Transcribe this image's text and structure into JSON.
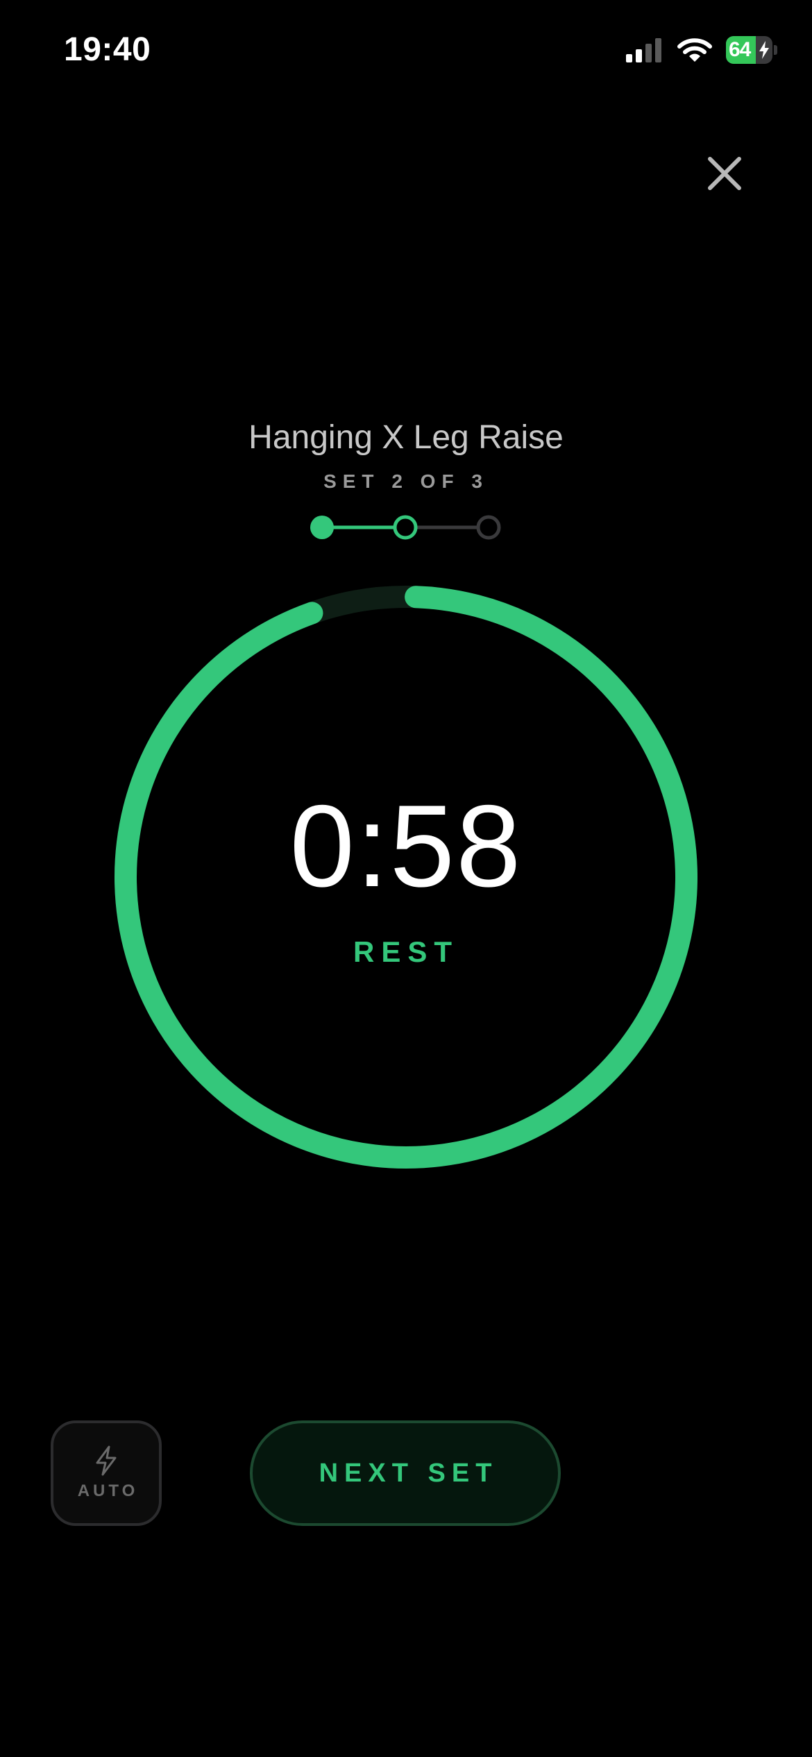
{
  "status_bar": {
    "time": "19:40",
    "battery_level": "64",
    "battery_fraction": 0.64,
    "icons": [
      "cellular-signal-icon",
      "wifi-icon",
      "battery-charging-icon"
    ]
  },
  "header": {
    "close_icon": "close-icon"
  },
  "exercise": {
    "title": "Hanging X Leg Raise",
    "set_label": "SET 2 OF 3",
    "current_set": 2,
    "total_sets": 3,
    "completed_sets": 1
  },
  "timer": {
    "value": "0:58",
    "caption": "REST",
    "remaining_fraction": 0.94
  },
  "actions": {
    "auto_icon": "lightning-bolt-icon",
    "auto_label": "AUTO",
    "next_set_label": "NEXT SET"
  },
  "colors": {
    "accent": "#34c77b",
    "background": "#000000",
    "ring_track": "#0e1e15",
    "pending_dot": "#3a3a3c"
  }
}
